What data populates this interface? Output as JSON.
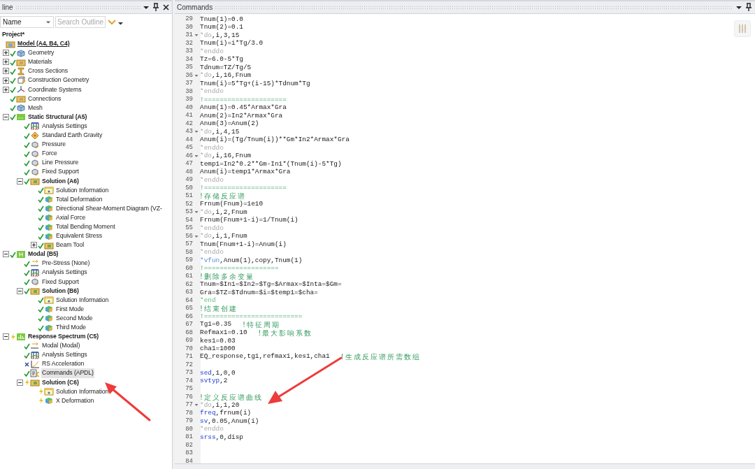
{
  "outline": {
    "title": "line",
    "column_select": "Name",
    "search": {
      "placeholder": "Search Outline"
    },
    "tree": [
      {
        "label": "Project*",
        "bold": true,
        "selected": false,
        "children": [
          {
            "label": "Model (A4, B4, C4)",
            "icon": {
              "kind": "model"
            },
            "bold": true,
            "underline": true,
            "selected": false,
            "children": [
              {
                "label": "Geometry",
                "icon": {
                  "kind": "geometry"
                },
                "kind": "ok",
                "expanded": false,
                "selected": false
              },
              {
                "label": "Materials",
                "icon": {
                  "kind": "materials"
                },
                "kind": "ok",
                "expanded": false,
                "selected": false
              },
              {
                "label": "Cross Sections",
                "icon": {
                  "kind": "section"
                },
                "kind": "ok",
                "expanded": false,
                "selected": false
              },
              {
                "label": "Construction Geometry",
                "icon": {
                  "kind": "construction"
                },
                "kind": "ok",
                "expanded": false,
                "selected": false
              },
              {
                "label": "Coordinate Systems",
                "icon": {
                  "kind": "coordinates"
                },
                "kind": "ok",
                "expanded": false,
                "selected": false
              },
              {
                "label": "Connections",
                "icon": {
                  "kind": "materials"
                },
                "kind": "ok",
                "selected": false
              },
              {
                "label": "Mesh",
                "icon": {
                  "kind": "geometry"
                },
                "kind": "ok",
                "selected": false
              },
              {
                "label": "Static Structural (A5)",
                "icon": {
                  "kind": "static"
                },
                "kind": "ok",
                "expanded": true,
                "bold": true,
                "selected": false,
                "children": [
                  {
                    "label": "Analysis Settings",
                    "icon": {
                      "kind": "settings"
                    },
                    "kind": "ok",
                    "selected": false
                  },
                  {
                    "label": "Standard Earth Gravity",
                    "icon": {
                      "kind": "gravity"
                    },
                    "kind": "ok",
                    "selected": false
                  },
                  {
                    "label": "Pressure",
                    "icon": {
                      "kind": "load"
                    },
                    "kind": "ok",
                    "selected": false
                  },
                  {
                    "label": "Force",
                    "icon": {
                      "kind": "load"
                    },
                    "kind": "ok",
                    "selected": false
                  },
                  {
                    "label": "Line Pressure",
                    "icon": {
                      "kind": "load"
                    },
                    "kind": "ok",
                    "selected": false
                  },
                  {
                    "label": "Fixed Support",
                    "icon": {
                      "kind": "load"
                    },
                    "kind": "ok",
                    "selected": false
                  },
                  {
                    "label": "Solution (A6)",
                    "icon": {
                      "kind": "solution"
                    },
                    "kind": "ok",
                    "expanded": true,
                    "bold": true,
                    "selected": false,
                    "children": [
                      {
                        "label": "Solution Information",
                        "icon": {
                          "kind": "info"
                        },
                        "kind": "ok",
                        "selected": false
                      },
                      {
                        "label": "Total Deformation",
                        "icon": {
                          "kind": "result"
                        },
                        "kind": "ok",
                        "selected": false
                      },
                      {
                        "label": "Directional Shear-Moment Diagram (VZ-",
                        "icon": {
                          "kind": "result"
                        },
                        "kind": "ok",
                        "selected": false
                      },
                      {
                        "label": "Axial Force",
                        "icon": {
                          "kind": "result"
                        },
                        "kind": "ok",
                        "selected": false
                      },
                      {
                        "label": "Total Bending Moment",
                        "icon": {
                          "kind": "result"
                        },
                        "kind": "ok",
                        "selected": false
                      },
                      {
                        "label": "Equivalent Stress",
                        "icon": {
                          "kind": "result"
                        },
                        "kind": "ok",
                        "selected": false
                      },
                      {
                        "label": "Beam Tool",
                        "icon": {
                          "kind": "solution"
                        },
                        "kind": "ok",
                        "expanded": false,
                        "selected": false
                      }
                    ]
                  }
                ]
              },
              {
                "label": "Modal (B5)",
                "icon": {
                  "kind": "modal"
                },
                "kind": "ok",
                "expanded": true,
                "bold": true,
                "selected": false,
                "children": [
                  {
                    "label": "Pre-Stress (None)",
                    "icon": {
                      "kind": "prestress"
                    },
                    "kind": "ok",
                    "selected": false
                  },
                  {
                    "label": "Analysis Settings",
                    "icon": {
                      "kind": "settings"
                    },
                    "kind": "ok",
                    "selected": false
                  },
                  {
                    "label": "Fixed Support",
                    "icon": {
                      "kind": "load"
                    },
                    "kind": "ok",
                    "selected": false
                  },
                  {
                    "label": "Solution (B6)",
                    "icon": {
                      "kind": "solution"
                    },
                    "kind": "ok",
                    "expanded": true,
                    "bold": true,
                    "selected": false,
                    "children": [
                      {
                        "label": "Solution Information",
                        "icon": {
                          "kind": "info"
                        },
                        "kind": "ok",
                        "selected": false
                      },
                      {
                        "label": "First Mode",
                        "icon": {
                          "kind": "result"
                        },
                        "kind": "ok",
                        "selected": false
                      },
                      {
                        "label": "Second Mode",
                        "icon": {
                          "kind": "result"
                        },
                        "kind": "ok",
                        "selected": false
                      },
                      {
                        "label": "Third Mode",
                        "icon": {
                          "kind": "result"
                        },
                        "kind": "ok",
                        "selected": false
                      }
                    ]
                  }
                ]
              },
              {
                "label": "Response Spectrum (C5)",
                "icon": {
                  "kind": "spectrum"
                },
                "kind": "pending",
                "expanded": true,
                "bold": true,
                "selected": false,
                "children": [
                  {
                    "label": "Modal (Modal)",
                    "icon": {
                      "kind": "prestress"
                    },
                    "kind": "ok",
                    "selected": false
                  },
                  {
                    "label": "Analysis Settings",
                    "icon": {
                      "kind": "settings"
                    },
                    "kind": "ok",
                    "selected": false
                  },
                  {
                    "label": "RS Acceleration",
                    "icon": {
                      "kind": "rsaccel"
                    },
                    "kind": "missing",
                    "selected": false
                  },
                  {
                    "label": "Commands (APDL)",
                    "icon": {
                      "kind": "commands"
                    },
                    "kind": "ok",
                    "selected": true
                  },
                  {
                    "label": "Solution (C6)",
                    "icon": {
                      "kind": "solution"
                    },
                    "kind": "pending",
                    "expanded": true,
                    "bold": true,
                    "selected": false,
                    "children": [
                      {
                        "label": "Solution Information",
                        "icon": {
                          "kind": "info"
                        },
                        "kind": "pending",
                        "selected": false
                      },
                      {
                        "label": "X  Deformation",
                        "icon": {
                          "kind": "result"
                        },
                        "kind": "pending",
                        "selected": false
                      }
                    ]
                  }
                ]
              }
            ]
          }
        ]
      }
    ]
  },
  "commands": {
    "title": "Commands",
    "lines": [
      {
        "n": "29",
        "parts": [
          {
            "t": "Tnum(1)=0.0",
            "kind": "plain"
          }
        ]
      },
      {
        "n": "30",
        "parts": [
          {
            "t": "Tnum(2)=0.1",
            "kind": "plain"
          }
        ]
      },
      {
        "n": "31",
        "fold": true,
        "parts": [
          {
            "t": "*do",
            "kind": "directive"
          },
          {
            "t": ",i,3,15",
            "kind": "plain"
          }
        ]
      },
      {
        "n": "32",
        "parts": [
          {
            "t": "Tnum(i)=i*Tg/3.0",
            "kind": "plain"
          }
        ]
      },
      {
        "n": "33",
        "parts": [
          {
            "t": "*enddo",
            "kind": "directive"
          }
        ]
      },
      {
        "n": "34",
        "parts": [
          {
            "t": "Tz=6.0-5*Tg",
            "kind": "plain"
          }
        ]
      },
      {
        "n": "35",
        "parts": [
          {
            "t": "Tdnum=TZ/Tg/5",
            "kind": "plain"
          }
        ]
      },
      {
        "n": "36",
        "fold": true,
        "parts": [
          {
            "t": "*do",
            "kind": "directive"
          },
          {
            "t": ",i,16,Fnum",
            "kind": "plain"
          }
        ]
      },
      {
        "n": "37",
        "parts": [
          {
            "t": "Tnum(i)=5*Tg+(i-15)*Tdnum*Tg",
            "kind": "plain"
          }
        ]
      },
      {
        "n": "38",
        "parts": [
          {
            "t": "*enddo",
            "kind": "directive"
          }
        ]
      },
      {
        "n": "39",
        "parts": [
          {
            "t": "!=====================",
            "kind": "comment"
          }
        ]
      },
      {
        "n": "40",
        "parts": [
          {
            "t": "Anum(1)=0.45*Armax*Gra",
            "kind": "plain"
          }
        ]
      },
      {
        "n": "41",
        "parts": [
          {
            "t": "Anum(2)=In2*Armax*Gra",
            "kind": "plain"
          }
        ]
      },
      {
        "n": "42",
        "parts": [
          {
            "t": "Anum(3)=Anum(2)",
            "kind": "plain"
          }
        ]
      },
      {
        "n": "43",
        "fold": true,
        "parts": [
          {
            "t": "*do",
            "kind": "directive"
          },
          {
            "t": ",i,4,15",
            "kind": "plain"
          }
        ]
      },
      {
        "n": "44",
        "parts": [
          {
            "t": "Anum(i)=(Tg/Tnum(i))**Gm*In2*Armax*Gra",
            "kind": "plain"
          }
        ]
      },
      {
        "n": "45",
        "parts": [
          {
            "t": "*enddo",
            "kind": "directive"
          }
        ]
      },
      {
        "n": "46",
        "fold": true,
        "parts": [
          {
            "t": "*do",
            "kind": "directive"
          },
          {
            "t": ",i,16,Fnum",
            "kind": "plain"
          }
        ]
      },
      {
        "n": "47",
        "parts": [
          {
            "t": "temp1=In2*0.2**Gm-In1*(Tnum(i)-5*Tg)",
            "kind": "plain"
          }
        ]
      },
      {
        "n": "48",
        "parts": [
          {
            "t": "Anum(i)=temp1*Armax*Gra",
            "kind": "plain"
          }
        ]
      },
      {
        "n": "49",
        "parts": [
          {
            "t": "*enddo",
            "kind": "directive"
          }
        ]
      },
      {
        "n": "50",
        "parts": [
          {
            "t": "!=====================",
            "kind": "comment"
          }
        ]
      },
      {
        "n": "51",
        "parts": [
          {
            "t": "!存储反应谱",
            "kind": "comment"
          }
        ]
      },
      {
        "n": "52",
        "parts": [
          {
            "t": "Frnum(Fnum)=1e10",
            "kind": "plain"
          }
        ]
      },
      {
        "n": "53",
        "fold": true,
        "parts": [
          {
            "t": "*do",
            "kind": "directive"
          },
          {
            "t": ",i,2,Fnum",
            "kind": "plain"
          }
        ]
      },
      {
        "n": "54",
        "parts": [
          {
            "t": "Frnum(Fnum+1-i)=1/Tnum(i)",
            "kind": "plain"
          }
        ]
      },
      {
        "n": "55",
        "parts": [
          {
            "t": "*enddo",
            "kind": "directive"
          }
        ]
      },
      {
        "n": "56",
        "fold": true,
        "parts": [
          {
            "t": "*do",
            "kind": "directive"
          },
          {
            "t": ",i,1,Fnum",
            "kind": "plain"
          }
        ]
      },
      {
        "n": "57",
        "parts": [
          {
            "t": "Tnum(Fnum+1-i)=Anum(i)",
            "kind": "plain"
          }
        ]
      },
      {
        "n": "58",
        "parts": [
          {
            "t": "*enddo",
            "kind": "directive"
          }
        ]
      },
      {
        "n": "59",
        "parts": [
          {
            "t": "*vfun",
            "kind": "macro"
          },
          {
            "t": ",Anum(1),copy,Tnum(1)",
            "kind": "plain"
          }
        ]
      },
      {
        "n": "60",
        "parts": [
          {
            "t": "!===================",
            "kind": "comment"
          }
        ]
      },
      {
        "n": "61",
        "parts": [
          {
            "t": "!删除多余变量",
            "kind": "comment"
          }
        ]
      },
      {
        "n": "62",
        "parts": [
          {
            "t": "Tnum=$In1=$In2=$Tg=$Armax=$Inta=$Gm=",
            "kind": "plain"
          }
        ]
      },
      {
        "n": "63",
        "parts": [
          {
            "t": "Gra=$TZ=$Tdnum=$i=$temp1=$cha=",
            "kind": "plain"
          }
        ]
      },
      {
        "n": "64",
        "parts": [
          {
            "t": "*end",
            "kind": "end"
          }
        ]
      },
      {
        "n": "65",
        "parts": [
          {
            "t": "!结束创建",
            "kind": "comment"
          }
        ]
      },
      {
        "n": "66",
        "parts": [
          {
            "t": "!=========================",
            "kind": "comment"
          }
        ]
      },
      {
        "n": "67",
        "parts": [
          {
            "t": "Tg1=0.35",
            "kind": "plain"
          },
          {
            "t": "!特征周期",
            "kind": "comment"
          }
        ]
      },
      {
        "n": "68",
        "parts": [
          {
            "t": "Refmax1=0.10",
            "kind": "plain"
          },
          {
            "t": "!最大影响系数",
            "kind": "comment"
          }
        ]
      },
      {
        "n": "69",
        "parts": [
          {
            "t": "kes1=0.03",
            "kind": "plain"
          }
        ]
      },
      {
        "n": "70",
        "parts": [
          {
            "t": "cha1=1000",
            "kind": "plain"
          }
        ]
      },
      {
        "n": "71",
        "parts": [
          {
            "t": "EQ_response,tg1,refmax1,kes1,cha1",
            "kind": "plain"
          },
          {
            "t": "!生成反应谱所需数组",
            "kind": "comment"
          }
        ]
      },
      {
        "n": "72"
      },
      {
        "n": "73",
        "parts": [
          {
            "t": "sed",
            "kind": "command"
          },
          {
            "t": ",1,0,0",
            "kind": "plain"
          }
        ]
      },
      {
        "n": "74",
        "parts": [
          {
            "t": "svtyp",
            "kind": "command"
          },
          {
            "t": ",2",
            "kind": "plain"
          }
        ]
      },
      {
        "n": "75"
      },
      {
        "n": "76",
        "parts": [
          {
            "t": "!定义反应谱曲线",
            "kind": "comment"
          }
        ]
      },
      {
        "n": "77",
        "fold": true,
        "parts": [
          {
            "t": "*do",
            "kind": "directive"
          },
          {
            "t": ",i,1,20",
            "kind": "plain"
          }
        ]
      },
      {
        "n": "78",
        "parts": [
          {
            "t": "freq",
            "kind": "command"
          },
          {
            "t": ",frnum(i)",
            "kind": "plain"
          }
        ]
      },
      {
        "n": "79",
        "parts": [
          {
            "t": "sv",
            "kind": "command"
          },
          {
            "t": ",0.05,Anum(i)",
            "kind": "plain"
          }
        ]
      },
      {
        "n": "80",
        "parts": [
          {
            "t": "*enddo",
            "kind": "directive"
          }
        ]
      },
      {
        "n": "81",
        "parts": [
          {
            "t": "srss",
            "kind": "command"
          },
          {
            "t": ",0,disp",
            "kind": "plain"
          }
        ]
      },
      {
        "n": "82"
      },
      {
        "n": "83"
      },
      {
        "n": "84"
      }
    ]
  }
}
